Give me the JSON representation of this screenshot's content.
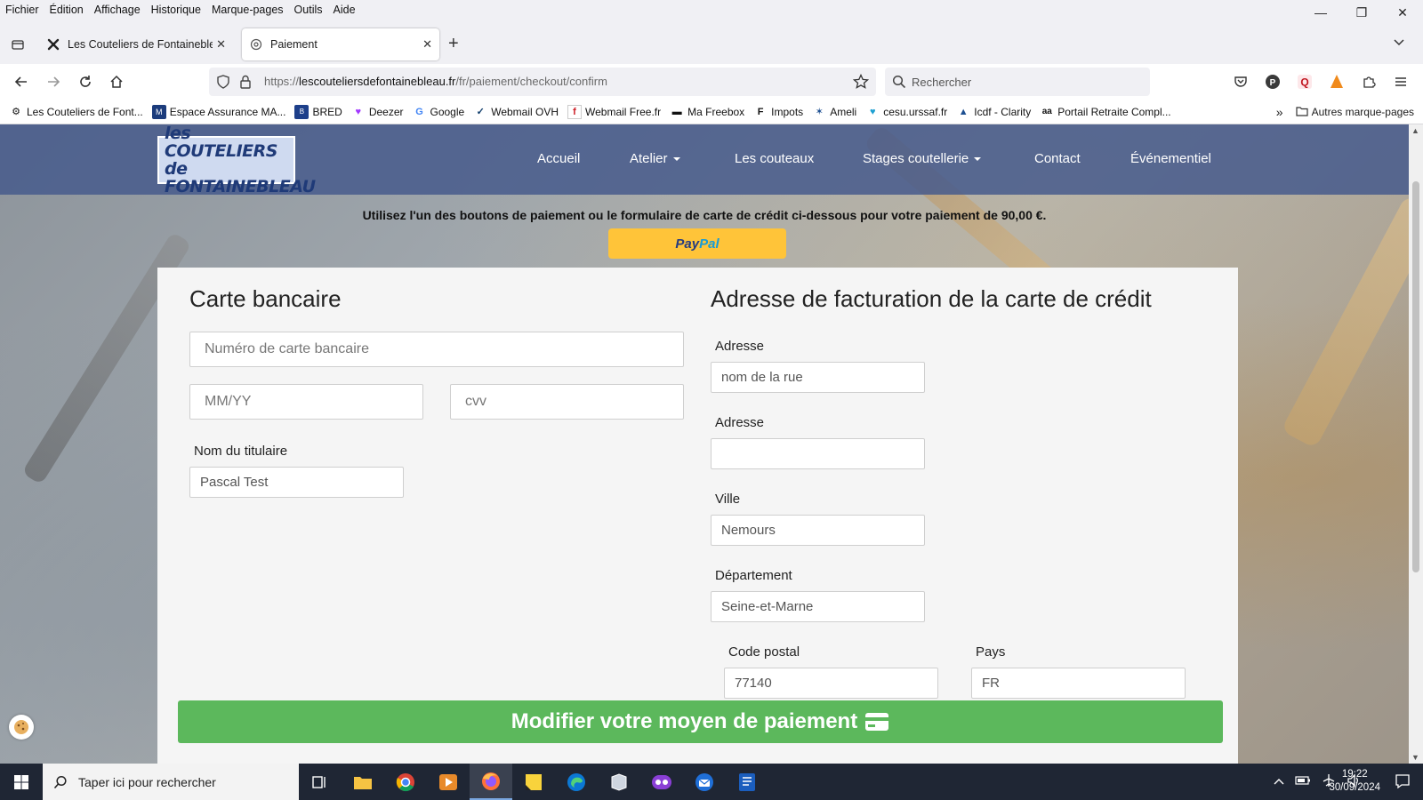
{
  "menu": [
    "Fichier",
    "Édition",
    "Affichage",
    "Historique",
    "Marque-pages",
    "Outils",
    "Aide"
  ],
  "window_controls": {
    "minimize": "—",
    "maximize": "❐",
    "close": "✕"
  },
  "tabs": [
    {
      "label": "Les Couteliers de Fontainebleau",
      "icon": "joomla-icon"
    },
    {
      "label": "Paiement",
      "icon": "page-icon"
    }
  ],
  "url": {
    "prefix": "https://",
    "domain": "lescouteliersdefontainebleau.fr",
    "path": "/fr/paiement/checkout/confirm"
  },
  "search": {
    "placeholder": "Rechercher"
  },
  "bookmarks": [
    {
      "label": "Les Couteliers de Font...",
      "icon": "site-icon"
    },
    {
      "label": "Espace Assurance MA...",
      "icon": "maif-icon"
    },
    {
      "label": "BRED",
      "icon": "bred-icon"
    },
    {
      "label": "Deezer",
      "icon": "heart-icon"
    },
    {
      "label": "Google",
      "icon": "google-icon"
    },
    {
      "label": "Webmail OVH",
      "icon": "ovh-icon"
    },
    {
      "label": "Webmail Free.fr",
      "icon": "free-icon"
    },
    {
      "label": "Ma Freebox",
      "icon": "freebox-icon"
    },
    {
      "label": "Impots",
      "icon": "impots-icon"
    },
    {
      "label": "Ameli",
      "icon": "ameli-icon"
    },
    {
      "label": "cesu.urssaf.fr",
      "icon": "cesu-icon"
    },
    {
      "label": "Icdf - Clarity",
      "icon": "clarity-icon"
    },
    {
      "label": "Portail Retraite Compl...",
      "icon": "retraite-icon"
    }
  ],
  "bookmarks_other": "Autres marque-pages",
  "site": {
    "logo_line1": "les COUTELIERS de",
    "logo_line2": "FONTAINEBLEAU",
    "nav": [
      "Accueil",
      "Atelier",
      "Les couteaux",
      "Stages coutellerie",
      "Contact",
      "Événementiel"
    ]
  },
  "payment": {
    "message": "Utilisez l'un des boutons de paiement ou le formulaire de carte de crédit ci-dessous pour votre paiement de 90,00 €.",
    "paypal_a": "Pay",
    "paypal_b": "Pal",
    "card_title": "Carte bancaire",
    "card_number_placeholder": "Numéro de carte bancaire",
    "expiry_placeholder": "MM/YY",
    "cvv_placeholder": "cvv",
    "holder_label": "Nom du titulaire",
    "holder_value": "Pascal Test",
    "billing_title": "Adresse de facturation de la carte de crédit",
    "address1_label": "Adresse",
    "address1_value": "nom de la rue",
    "address2_label": "Adresse",
    "address2_value": "",
    "city_label": "Ville",
    "city_value": "Nemours",
    "dept_label": "Département",
    "dept_value": "Seine-et-Marne",
    "zip_label": "Code postal",
    "zip_value": "77140",
    "country_label": "Pays",
    "country_value": "FR",
    "modify_button": "Modifier votre moyen de paiement"
  },
  "taskbar": {
    "search_placeholder": "Taper ici pour rechercher",
    "time": "19:22",
    "date": "30/09/2024"
  }
}
